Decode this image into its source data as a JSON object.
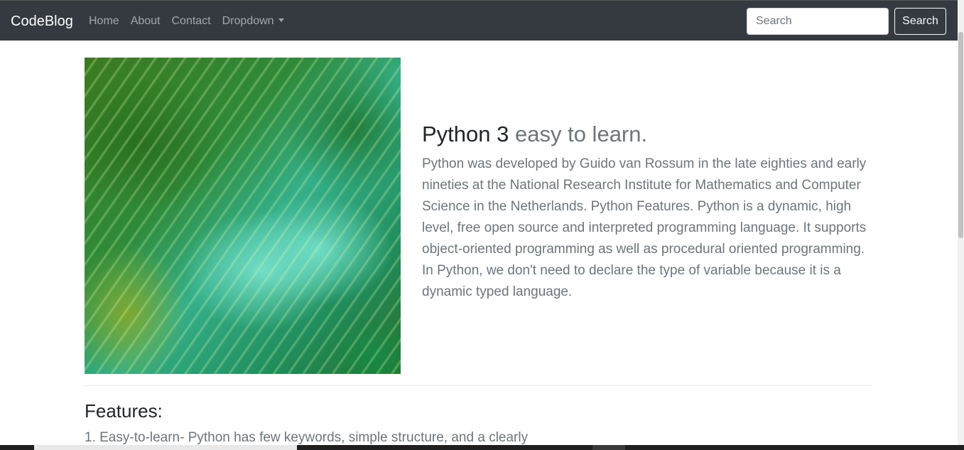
{
  "navbar": {
    "brand": "CodeBlog",
    "links": [
      {
        "label": "Home"
      },
      {
        "label": "About"
      },
      {
        "label": "Contact"
      },
      {
        "label": "Dropdown"
      }
    ],
    "search": {
      "placeholder": "Search",
      "button_label": "Search"
    }
  },
  "hero": {
    "image_icon": "landscape-photo",
    "title_main": "Python 3",
    "title_muted": "easy to learn.",
    "body": "Python was developed by Guido van Rossum in the late eighties and early nineties at the National Research Institute for Mathematics and Computer Science in the Netherlands. Python Features. Python is a dynamic, high level, free open source and interpreted programming language. It supports object-oriented programming as well as procedural oriented programming. In Python, we don't need to declare the type of variable because it is a dynamic typed language."
  },
  "features": {
    "title": "Features:",
    "first_item": "1. Easy-to-learn- Python has few keywords, simple structure, and a clearly"
  },
  "colors": {
    "navbar_bg": "#343a40",
    "text_dark": "#212529",
    "text_muted": "#6c757d"
  }
}
